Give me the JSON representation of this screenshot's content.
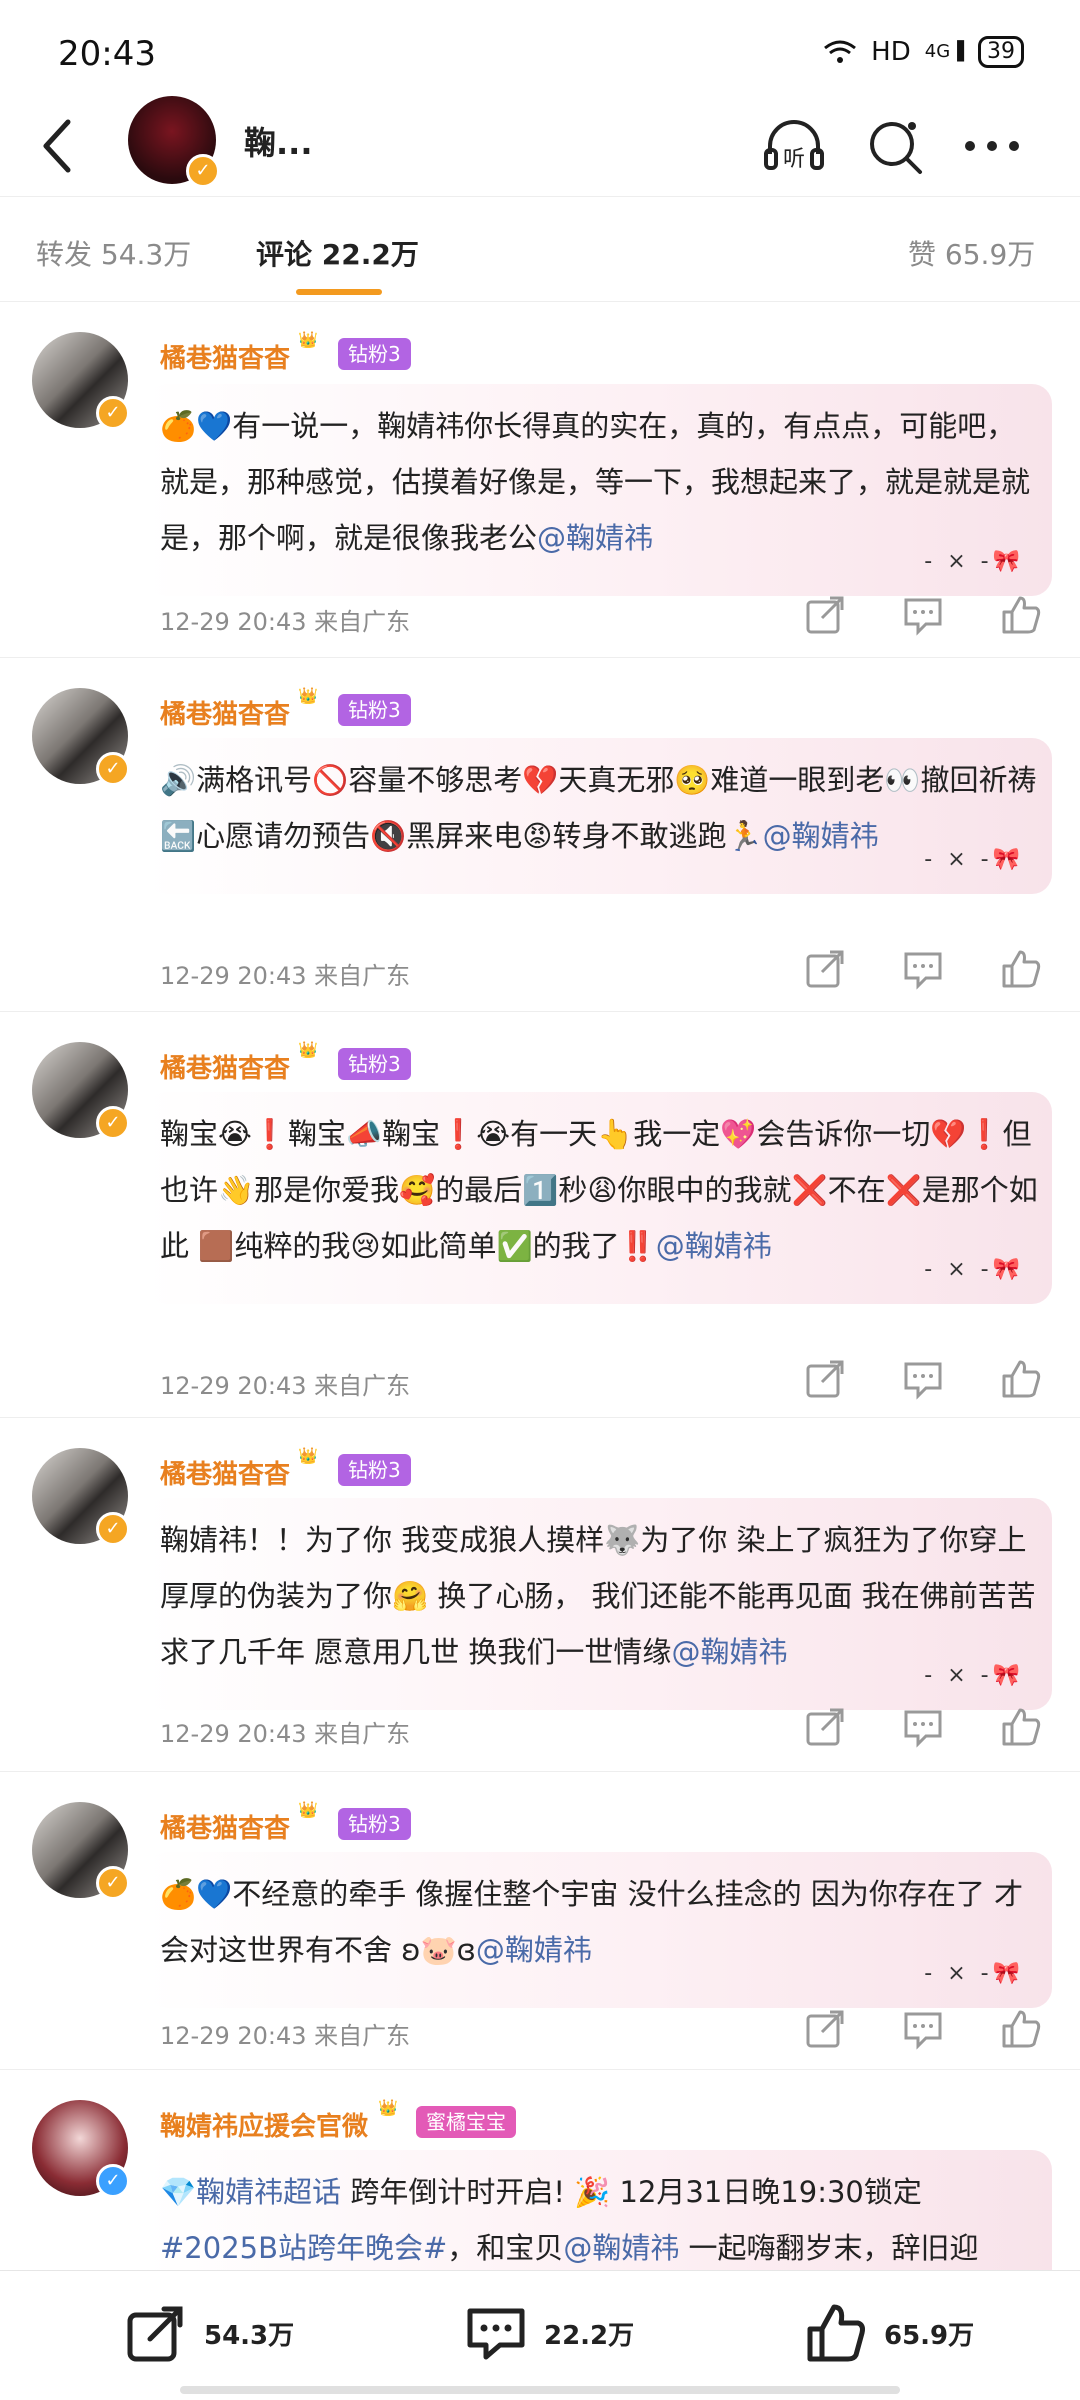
{
  "status": {
    "time": "20:43",
    "network": "HD",
    "signal": "4G",
    "battery": "39"
  },
  "header": {
    "title": "鞠...",
    "icons": [
      "back-icon",
      "listen-icon",
      "search-icon",
      "more-icon"
    ],
    "listen_label": "听"
  },
  "tabs": [
    {
      "label": "转发",
      "count": "54.3万"
    },
    {
      "label": "评论",
      "count": "22.2万",
      "active": true
    },
    {
      "label": "赞",
      "count": "65.9万"
    }
  ],
  "comments": [
    {
      "user": "橘巷猫杳杳",
      "badge": "钻粉3",
      "text": "🍊💙有一说一，鞠婧祎你长得真的实在，真的，有点点，可能吧，就是，那种感觉，估摸着好像是，等一下，我想起来了，就是就是就是，那个啊，就是很像我老公",
      "mention": "@鞠婧祎",
      "meta": "12-29  20:43  来自广东"
    },
    {
      "user": "橘巷猫杳杳",
      "badge": "钻粉3",
      "text": "🔊满格讯号🚫容量不够思考💔天真无邪🥺难道一眼到老👀撤回祈祷🔙心愿请勿预告🔇黑屏来电😡转身不敢逃跑🏃",
      "mention": "@鞠婧祎",
      "meta": "12-29  20:43  来自广东"
    },
    {
      "user": "橘巷猫杳杳",
      "badge": "钻粉3",
      "text": "鞠宝😭❗鞠宝📣鞠宝❗😭有一天👆我一定💖会告诉你一切💔❗但也许👋那是你爱我🥰的最后1️⃣秒😩你眼中的我就❌不在❌是那个如此 🟫纯粹的我😢如此简单✅的我了‼️",
      "mention": "@鞠婧祎",
      "meta": "12-29  20:43  来自广东"
    },
    {
      "user": "橘巷猫杳杳",
      "badge": "钻粉3",
      "text": "鞠婧祎！！为了你  我变成狼人摸样🐺为了你  染上了疯狂为了你穿上厚厚的伪装为了你🤗 换了心肠，  我们还能不能再见面  我在佛前苦苦求了几千年  愿意用几世  换我们一世情缘",
      "mention": "@鞠婧祎",
      "meta": "12-29  20:43  来自广东"
    },
    {
      "user": "橘巷猫杳杳",
      "badge": "钻粉3",
      "text": "🍊💙不经意的牵手    像握住整个宇宙    没什么挂念的    因为你存在了    才会对这世界有不舍  ʚ🐷ɞ",
      "mention": "@鞠婧祎",
      "meta": "12-29  20:43  来自广东"
    },
    {
      "user": "鞠婧祎应援会官微",
      "badge": "蜜橘宝宝",
      "text_parts": [
        "💎鞠婧祎超话",
        "  跨年倒计时开启! 🎉 12月31日晚19:30锁定",
        "#2025B站跨年晚会#",
        "，和宝贝",
        "@鞠婧祎",
        "  一起嗨翻岁末，辞旧迎"
      ]
    }
  ],
  "deco": "- × -🎀",
  "bottom": {
    "repost": "54.3万",
    "comment": "22.2万",
    "like": "65.9万"
  }
}
